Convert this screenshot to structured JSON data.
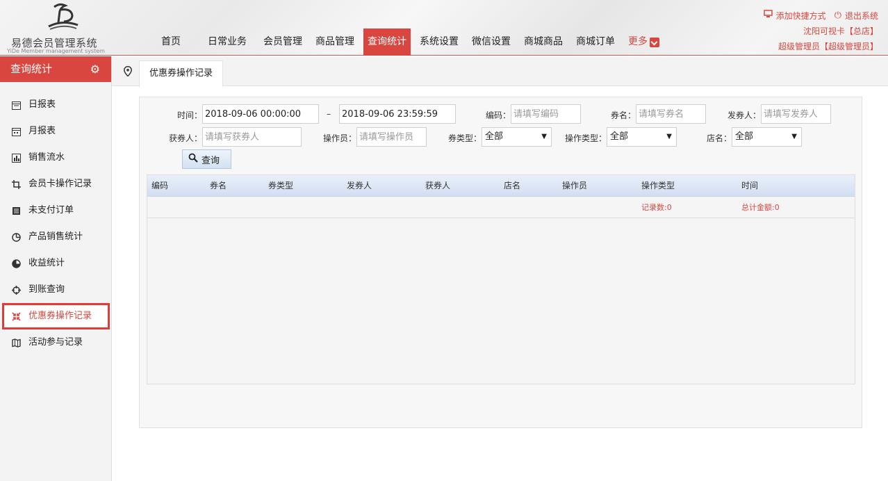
{
  "app": {
    "title": "易德会员管理系统",
    "subtitle": "YiDe Member management system"
  },
  "nav": {
    "items": [
      "首页",
      "日常业务",
      "会员管理",
      "商品管理",
      "查询统计",
      "系统设置",
      "微信设置",
      "商城商品",
      "商城订单"
    ],
    "active_index": 4,
    "more": "更多"
  },
  "top_right": {
    "add_shortcut": "添加快捷方式",
    "logout": "退出系统",
    "store": "沈阳可视卡【总店】",
    "user": "超级管理员【超级管理员】"
  },
  "sidebar": {
    "title": "查询统计",
    "items": [
      {
        "label": "日报表",
        "icon": "calendar-icon"
      },
      {
        "label": "月报表",
        "icon": "calendar-month-icon"
      },
      {
        "label": "销售流水",
        "icon": "bar-chart-icon"
      },
      {
        "label": "会员卡操作记录",
        "icon": "crop-icon"
      },
      {
        "label": "未支付订单",
        "icon": "list-icon"
      },
      {
        "label": "产品销售统计",
        "icon": "pie-chart-icon"
      },
      {
        "label": "收益统计",
        "icon": "half-circle-icon"
      },
      {
        "label": "到账查询",
        "icon": "crosshair-icon"
      },
      {
        "label": "优惠券操作记录",
        "icon": "compress-icon"
      },
      {
        "label": "活动参与记录",
        "icon": "map-book-icon"
      }
    ],
    "active_index": 8
  },
  "tab": {
    "label": "优惠券操作记录"
  },
  "filters": {
    "time_label": "时间：",
    "time_start": "2018-09-06 00:00:00",
    "time_sep": "–",
    "time_end": "2018-09-06 23:59:59",
    "code_label": "编码：",
    "code_placeholder": "请填写编码",
    "name_label": "券名：",
    "name_placeholder": "请填写券名",
    "issuer_label": "发券人：",
    "issuer_placeholder": "请填写发券人",
    "receiver_label": "获券人：",
    "receiver_placeholder": "请填写获券人",
    "operator_label": "操作员：",
    "operator_placeholder": "请填写操作员",
    "type_label": "券类型：",
    "type_value": "全部",
    "optype_label": "操作类型：",
    "optype_value": "全部",
    "store_label": "店名：",
    "store_value": "全部",
    "query_button": "查询"
  },
  "table": {
    "columns": [
      "编码",
      "券名",
      "券类型",
      "发券人",
      "获券人",
      "店名",
      "操作员",
      "操作类型",
      "时间"
    ],
    "record_count": "记录数:0",
    "total_amount": "总计金额:0"
  },
  "colors": {
    "accent": "#d9463f",
    "highlight_border": "#e53935",
    "grid_header": "#dce6f4"
  }
}
